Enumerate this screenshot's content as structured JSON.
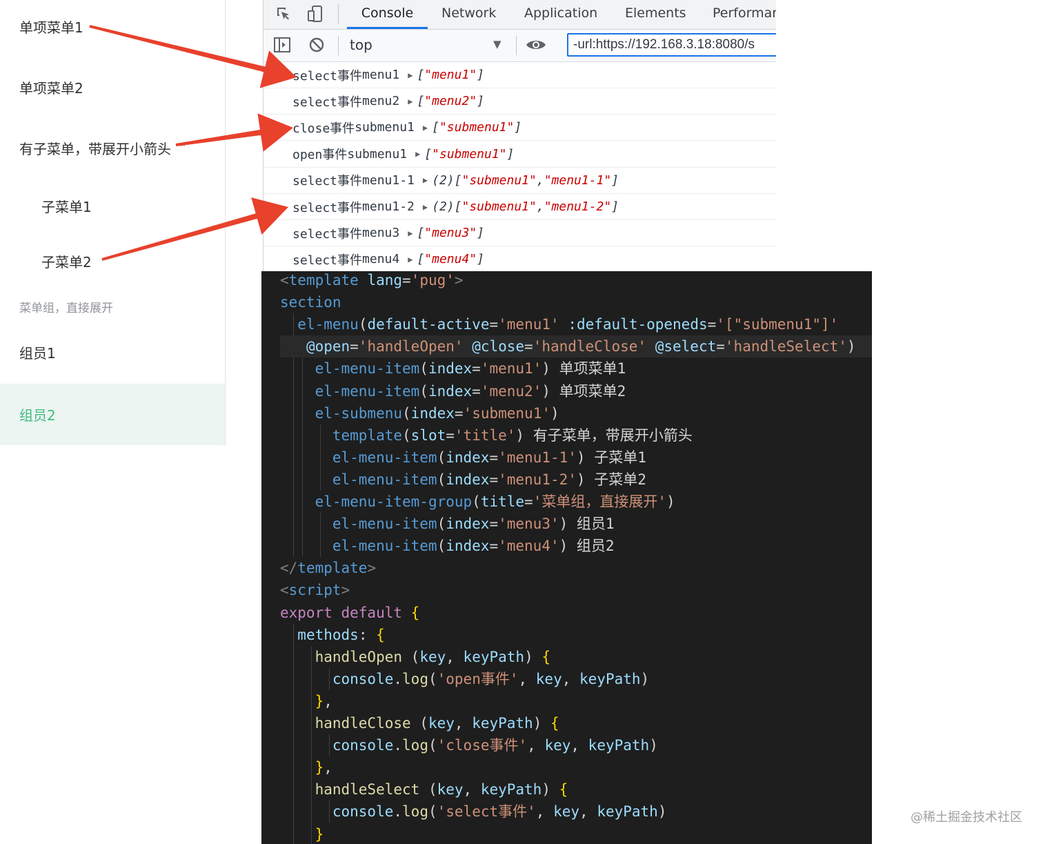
{
  "menu": {
    "item1": "单项菜单1",
    "item2": "单项菜单2",
    "submenu_title": "有子菜单，带展开小箭头",
    "sub1": "子菜单1",
    "sub2": "子菜单2",
    "group_title": "菜单组，直接展开",
    "member1": "组员1",
    "member2": "组员2",
    "active_item": "组员2",
    "accent_color": "#42b983"
  },
  "devtools": {
    "tabs": [
      "Console",
      "Network",
      "Application",
      "Elements",
      "Performar"
    ],
    "selected_tab": "Console",
    "icons": [
      "inspect-icon",
      "device-toggle-icon",
      "sidebar-icon",
      "clear-console-icon",
      "eye-icon"
    ],
    "context": "top",
    "filter_value": "-url:https://192.168.3.18:8080/s",
    "logs": [
      {
        "event": "select事件",
        "key": "menu1",
        "count": "",
        "items": [
          "menu1"
        ]
      },
      {
        "event": "select事件",
        "key": "menu2",
        "count": "",
        "items": [
          "menu2"
        ]
      },
      {
        "event": "close事件",
        "key": "submenu1",
        "count": "",
        "items": [
          "submenu1"
        ]
      },
      {
        "event": "open事件",
        "key": "submenu1",
        "count": "",
        "items": [
          "submenu1"
        ]
      },
      {
        "event": "select事件",
        "key": "menu1-1",
        "count": "(2)",
        "items": [
          "submenu1",
          "menu1-1"
        ]
      },
      {
        "event": "select事件",
        "key": "menu1-2",
        "count": "(2)",
        "items": [
          "submenu1",
          "menu1-2"
        ]
      },
      {
        "event": "select事件",
        "key": "menu3",
        "count": "",
        "items": [
          "menu3"
        ]
      },
      {
        "event": "select事件",
        "key": "menu4",
        "count": "",
        "items": [
          "menu4"
        ]
      }
    ]
  },
  "code": {
    "lines": [
      "<template lang='pug'>",
      "section",
      "  el-menu(default-active='menu1' :default-openeds='[\"submenu1\"]'",
      "   @open='handleOpen' @close='handleClose' @select='handleSelect')",
      "    el-menu-item(index='menu1') 单项菜单1",
      "    el-menu-item(index='menu2') 单项菜单2",
      "    el-submenu(index='submenu1')",
      "      template(slot='title') 有子菜单，带展开小箭头",
      "      el-menu-item(index='menu1-1') 子菜单1",
      "      el-menu-item(index='menu1-2') 子菜单2",
      "    el-menu-item-group(title='菜单组，直接展开')",
      "      el-menu-item(index='menu3') 组员1",
      "      el-menu-item(index='menu4') 组员2",
      "</template>",
      "<script>",
      "export default {",
      "  methods: {",
      "    handleOpen (key, keyPath) {",
      "      console.log('open事件', key, keyPath)",
      "    },",
      "    handleClose (key, keyPath) {",
      "      console.log('close事件', key, keyPath)",
      "    },",
      "    handleSelect (key, keyPath) {",
      "      console.log('select事件', key, keyPath)",
      "    }"
    ]
  },
  "annotations": {
    "arrow_color": "#e8412c"
  },
  "watermark": "@稀土掘金技术社区"
}
